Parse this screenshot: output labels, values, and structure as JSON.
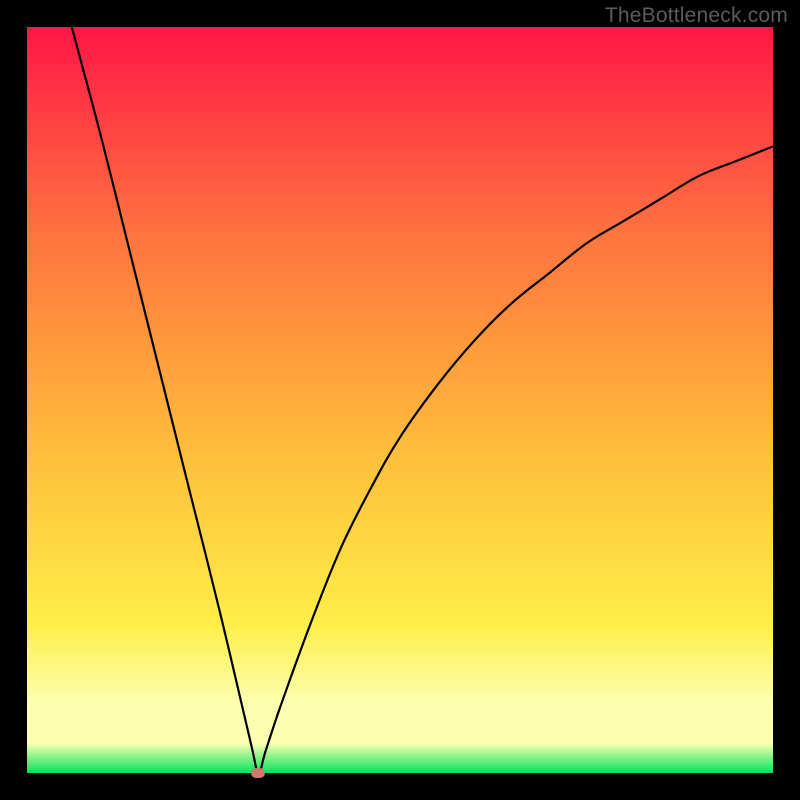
{
  "watermark": "TheBottleneck.com",
  "colors": {
    "background_black": "#000000",
    "gradient_top": "#ff1646",
    "gradient_upper": "#ff743f",
    "gradient_mid": "#ffb93b",
    "gradient_lower": "#ffee47",
    "gradient_pale": "#fcffb0",
    "gradient_bottom": "#02e35b",
    "curve": "#000000",
    "marker": "#cd786b"
  },
  "chart_data": {
    "type": "line",
    "title": "",
    "xlabel": "",
    "ylabel": "",
    "xlim": [
      0,
      100
    ],
    "ylim": [
      0,
      100
    ],
    "series": [
      {
        "name": "bottleneck-curve",
        "comment": "V-shaped curve; y≈100 at x≈6, drops to y≈0 at x≈31, rises asymptotically toward y≈84 at x=100",
        "x": [
          6,
          10,
          14,
          18,
          22,
          26,
          30,
          31,
          32,
          34,
          38,
          42,
          46,
          50,
          55,
          60,
          65,
          70,
          75,
          80,
          85,
          90,
          95,
          100
        ],
        "y": [
          100,
          85,
          69,
          53,
          37,
          21,
          4,
          0,
          3,
          9,
          20,
          30,
          38,
          45,
          52,
          58,
          63,
          67,
          71,
          74,
          77,
          80,
          82,
          84
        ]
      }
    ],
    "marker": {
      "x": 31,
      "y": 0,
      "name": "optimal-point"
    },
    "gradient_stops": [
      {
        "offset": 0.0,
        "color_key": "gradient_top"
      },
      {
        "offset": 0.28,
        "color_key": "gradient_upper"
      },
      {
        "offset": 0.55,
        "color_key": "gradient_mid"
      },
      {
        "offset": 0.8,
        "color_key": "gradient_lower"
      },
      {
        "offset": 0.905,
        "color_key": "gradient_pale"
      },
      {
        "offset": 0.96,
        "color_key": "gradient_pale"
      },
      {
        "offset": 1.0,
        "color_key": "gradient_bottom"
      }
    ]
  }
}
